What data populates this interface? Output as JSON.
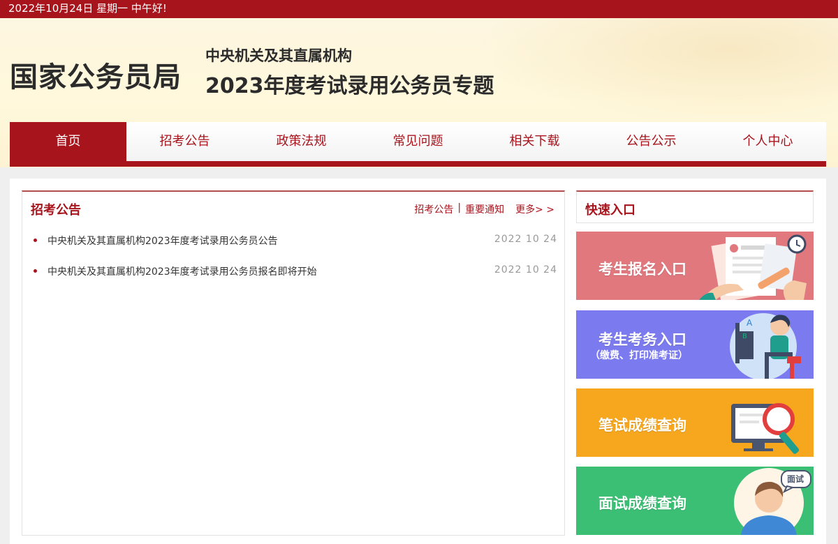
{
  "topbar": {
    "date_text": "2022年10月24日  星期一  中午好!"
  },
  "header": {
    "logo": "国家公务员局",
    "subtitle_line1": "中央机关及其直属机构",
    "subtitle_line2": "2023年度考试录用公务员专题"
  },
  "nav": {
    "items": [
      {
        "label": "首页",
        "active": true
      },
      {
        "label": "招考公告"
      },
      {
        "label": "政策法规"
      },
      {
        "label": "常见问题"
      },
      {
        "label": "相关下载"
      },
      {
        "label": "公告公示"
      },
      {
        "label": "个人中心"
      }
    ]
  },
  "notices": {
    "title": "招考公告",
    "links": [
      "招考公告",
      "|",
      "重要通知"
    ],
    "more": "更多> >",
    "items": [
      {
        "title": "中央机关及其直属机构2023年度考试录用公务员公告",
        "date": "2022 10 24"
      },
      {
        "title": "中央机关及其直属机构2023年度考试录用公务员报名即将开始",
        "date": "2022 10 24"
      }
    ]
  },
  "quick": {
    "title": "快速入口",
    "banners": [
      {
        "label": "考生报名入口",
        "color": "#e0787e"
      },
      {
        "label": "考生考务入口",
        "sub": "（缴费、打印准考证）",
        "color": "#7b7bef"
      },
      {
        "label": "笔试成绩查询",
        "color": "#f7a71e"
      },
      {
        "label": "面试成绩查询",
        "badge": "面试",
        "color": "#3bbf74"
      }
    ]
  },
  "colors": {
    "brand_red": "#a8141c"
  }
}
